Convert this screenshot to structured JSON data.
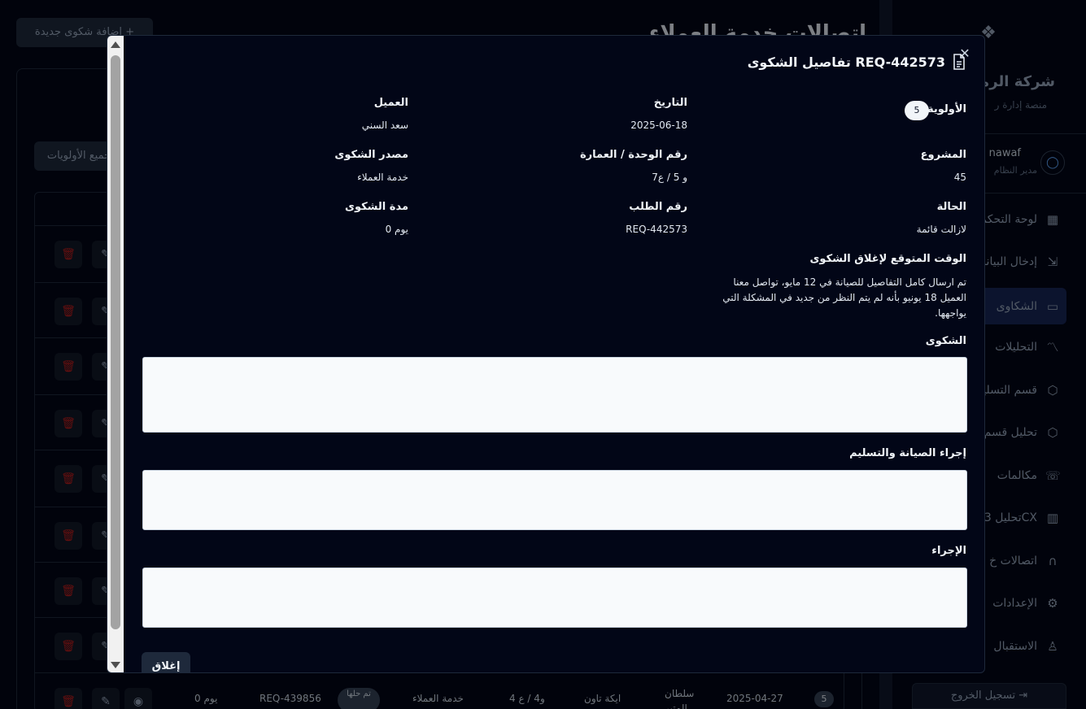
{
  "background": {
    "page_title": "اتصالات خدمة العملاء",
    "add_button": "إضافة شكوى جديدة",
    "filter_button": "جميع الأولويات",
    "sidebar": {
      "company": "شركة الرمز",
      "company_sub": "منصة إدارة ر",
      "user_name": "nawaf",
      "user_role": "مدير النظام",
      "items": [
        {
          "label": "لوحة التحكم",
          "icon": "grid-icon"
        },
        {
          "label": "إدخال البيانات",
          "icon": "import-icon"
        },
        {
          "label": "الشكاوى",
          "icon": "message-icon"
        },
        {
          "label": "التحليلات",
          "icon": "chart-line-icon"
        },
        {
          "label": "قسم التسليم",
          "icon": "box-icon"
        },
        {
          "label": "تحليل قسم",
          "icon": "box-icon"
        },
        {
          "label": "مكالمات",
          "icon": "phone-icon"
        },
        {
          "label": "تحليل 3CX",
          "icon": "bar-chart-icon"
        },
        {
          "label": "اتصالات خ",
          "icon": "headset-icon"
        },
        {
          "label": "الإعدادات",
          "icon": "gear-icon"
        },
        {
          "label": "الاستقبال",
          "icon": "user-icon"
        }
      ],
      "logout": "تسجيل الخروج"
    },
    "last_row": {
      "priority": "5",
      "date": "2025-04-27",
      "customer": "سلطان المتير",
      "project": "ايكة تاون",
      "unit": "و4 / ع 4",
      "source": "خدمة العملاء",
      "status": "تم حلها",
      "request": "REQ-439856",
      "duration": "0 يوم"
    }
  },
  "modal": {
    "title": "تفاصيل الشكوى REQ-442573",
    "fields": {
      "priority_label": "الأولوية",
      "priority_value": "5",
      "date_label": "التاريخ",
      "date_value": "2025-06-18",
      "customer_label": "العميل",
      "customer_value": "سعد السني",
      "project_label": "المشروع",
      "project_value": "45",
      "unit_label": "رقم الوحدة / العمارة",
      "unit_value": "و 5 / ع7",
      "source_label": "مصدر الشكوى",
      "source_value": "خدمة العملاء",
      "status_label": "الحالة",
      "status_value": "لازالت قائمة",
      "request_label": "رقم الطلب",
      "request_value": "REQ-442573",
      "duration_label": "مدة الشكوى",
      "duration_value": "0 يوم",
      "expected_label": "الوقت المتوقع لإغلاق الشكوى",
      "expected_value": "تم ارسال كامل التفاصيل للصيانة في 12 مايو، تواصل معنا العميل 18 يونيو بأنه لم يتم النظر من جديد في المشكلة التي يواجهها."
    },
    "complaint_label": "الشكوى",
    "maintenance_label": "إجراء الصيانة والتسليم",
    "action_label": "الإجراء",
    "close_button": "إغلاق"
  }
}
